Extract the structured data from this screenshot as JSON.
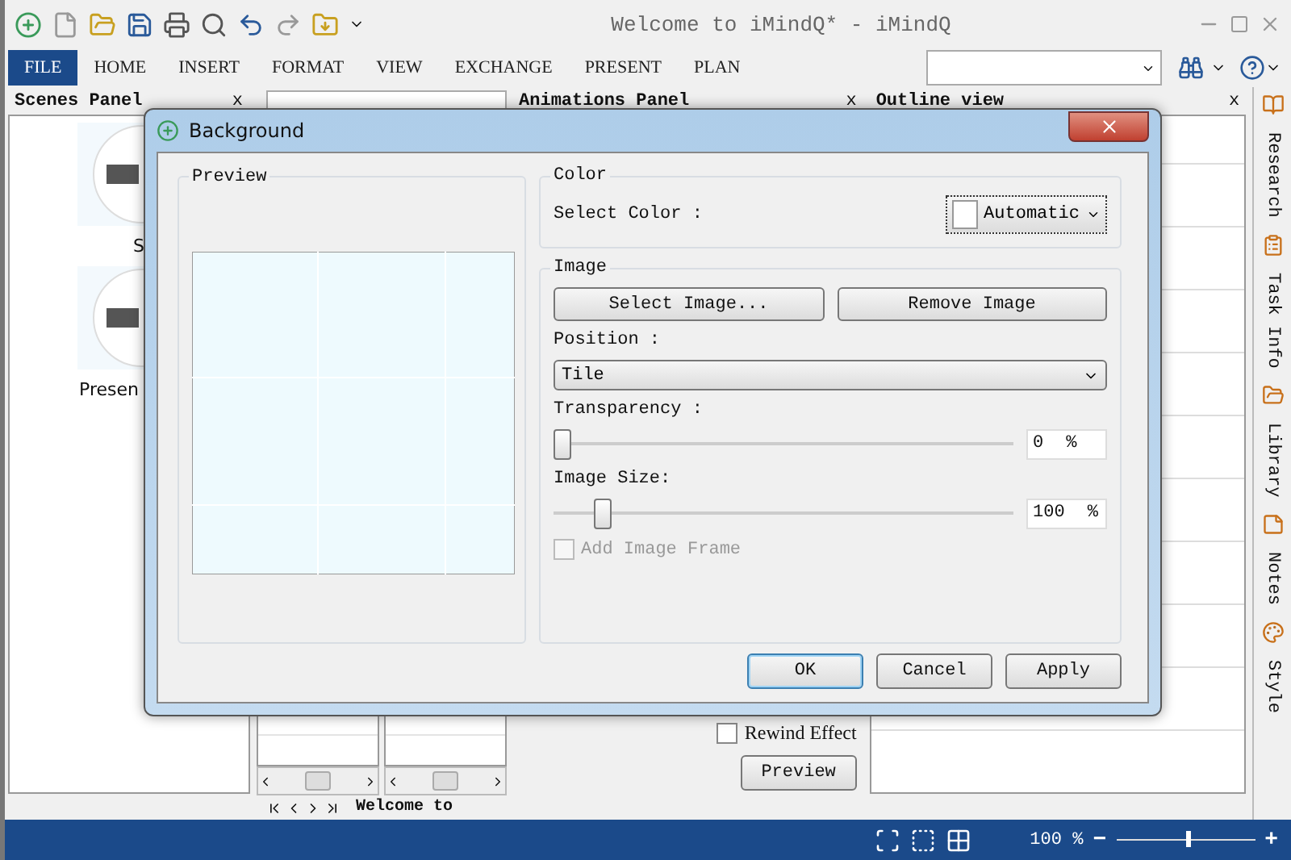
{
  "window": {
    "title": "Welcome to iMindQ* - iMindQ"
  },
  "menu": [
    {
      "label": "FILE",
      "selected": true
    },
    {
      "label": "HOME",
      "selected": false
    },
    {
      "label": "INSERT",
      "selected": false
    },
    {
      "label": "FORMAT",
      "selected": false
    },
    {
      "label": "VIEW",
      "selected": false
    },
    {
      "label": "EXCHANGE",
      "selected": false
    },
    {
      "label": "PRESENT",
      "selected": false
    },
    {
      "label": "PLAN",
      "selected": false
    }
  ],
  "scenes_panel": {
    "title": "Scenes Panel",
    "close": "x",
    "scenes": [
      {
        "caption": "S"
      },
      {
        "caption": "Presen"
      }
    ]
  },
  "slides_strip": {
    "tab": "Welcome to"
  },
  "animations_panel": {
    "title": "Animations Panel",
    "close": "x",
    "rewind_effect": {
      "label": "Rewind Effect",
      "checked": false
    },
    "preview_button": "Preview"
  },
  "outline_view": {
    "title": "Outline view",
    "close": "x"
  },
  "side_tabs": [
    {
      "label": "Research"
    },
    {
      "label": "Task Info"
    },
    {
      "label": "Library"
    },
    {
      "label": "Notes"
    },
    {
      "label": "Style"
    }
  ],
  "status_bar": {
    "zoom": "100 %",
    "zoom_out": "−",
    "zoom_in": "+",
    "level": 0.5
  },
  "dialog": {
    "title": "Background",
    "preview_group": "Preview",
    "color_group": "Color",
    "select_color_label": "Select Color :",
    "color_value": "Automatic",
    "image_group": "Image",
    "select_image": "Select Image...",
    "remove_image": "Remove Image",
    "position_label": "Position :",
    "position_value": "Tile",
    "transparency_label": "Transparency :",
    "transparency": {
      "level": 0,
      "value": "0",
      "unit": "%"
    },
    "size_label": "Image Size:",
    "size": {
      "level": 0.09,
      "value": "100",
      "unit": "%"
    },
    "frame": {
      "label": "Add Image Frame",
      "checked": false,
      "disabled": true
    },
    "buttons": [
      {
        "label": "OK",
        "selected": true
      },
      {
        "label": "Cancel",
        "selected": false
      },
      {
        "label": "Apply",
        "selected": false
      }
    ]
  }
}
